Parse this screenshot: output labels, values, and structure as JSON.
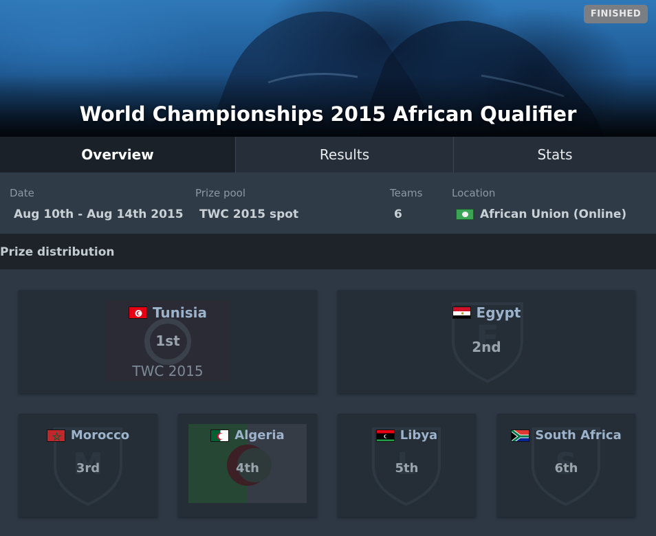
{
  "event": {
    "title": "World Championships 2015 African Qualifier",
    "status": "FINISHED"
  },
  "tabs": [
    {
      "label": "Overview",
      "active": true
    },
    {
      "label": "Results",
      "active": false
    },
    {
      "label": "Stats",
      "active": false
    }
  ],
  "info": {
    "date": {
      "label": "Date",
      "value": "Aug 10th - Aug 14th 2015"
    },
    "prize_pool": {
      "label": "Prize pool",
      "value": "TWC 2015 spot"
    },
    "teams": {
      "label": "Teams",
      "value": "6"
    },
    "location": {
      "label": "Location",
      "value": "African Union (Online)",
      "flag_icon": "african-union-flag-icon"
    }
  },
  "prize_distribution": {
    "title": "Prize distribution",
    "placements": [
      {
        "team": "Tunisia",
        "place": "1st",
        "prize": "TWC 2015",
        "flag_icon": "tunisia-flag-icon"
      },
      {
        "team": "Egypt",
        "place": "2nd",
        "prize": "",
        "flag_icon": "egypt-flag-icon"
      },
      {
        "team": "Morocco",
        "place": "3rd",
        "prize": "",
        "flag_icon": "morocco-flag-icon"
      },
      {
        "team": "Algeria",
        "place": "4th",
        "prize": "",
        "flag_icon": "algeria-flag-icon"
      },
      {
        "team": "Libya",
        "place": "5th",
        "prize": "",
        "flag_icon": "libya-flag-icon"
      },
      {
        "team": "South Africa",
        "place": "6th",
        "prize": "",
        "flag_icon": "south-africa-flag-icon"
      }
    ]
  },
  "colors": {
    "page_bg": "#2d3844",
    "team_name": "#9cb3cb",
    "badge_bg": "#7b7f83"
  }
}
